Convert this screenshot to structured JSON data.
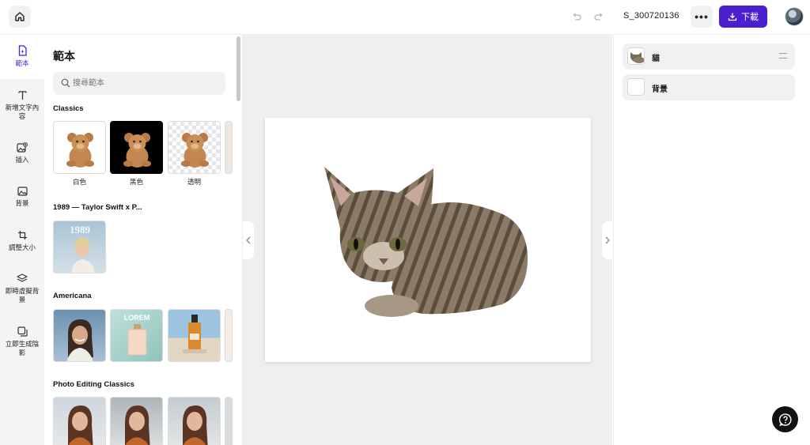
{
  "topbar": {
    "project_name": "S_300720136",
    "more_label": "•••",
    "download_label": "下載"
  },
  "rail": {
    "items": [
      {
        "label": "範本",
        "icon": "template-icon",
        "active": true
      },
      {
        "label": "新增文字內容",
        "icon": "text-icon"
      },
      {
        "label": "插入",
        "icon": "insert-image-icon"
      },
      {
        "label": "背景",
        "icon": "background-icon"
      },
      {
        "label": "調整大小",
        "icon": "crop-icon"
      },
      {
        "label": "即時虛擬背景",
        "icon": "layers-icon"
      },
      {
        "label": "立即生成陰影",
        "icon": "shadow-icon"
      }
    ]
  },
  "panel": {
    "title": "範本",
    "search_placeholder": "搜尋範本",
    "sections": [
      {
        "title": "Classics",
        "items": [
          "白色",
          "黑色",
          "透明"
        ]
      },
      {
        "title": "1989 — Taylor Swift x P..."
      },
      {
        "title": "Americana"
      },
      {
        "title": "Photo Editing Classics"
      }
    ],
    "album_text": "1989"
  },
  "layers": {
    "items": [
      {
        "name": "貓"
      },
      {
        "name": "背景"
      }
    ]
  },
  "colors": {
    "accent": "#4a1fd0",
    "panel_bg": "#f1f1f3",
    "canvas_bg": "#efeff1"
  }
}
